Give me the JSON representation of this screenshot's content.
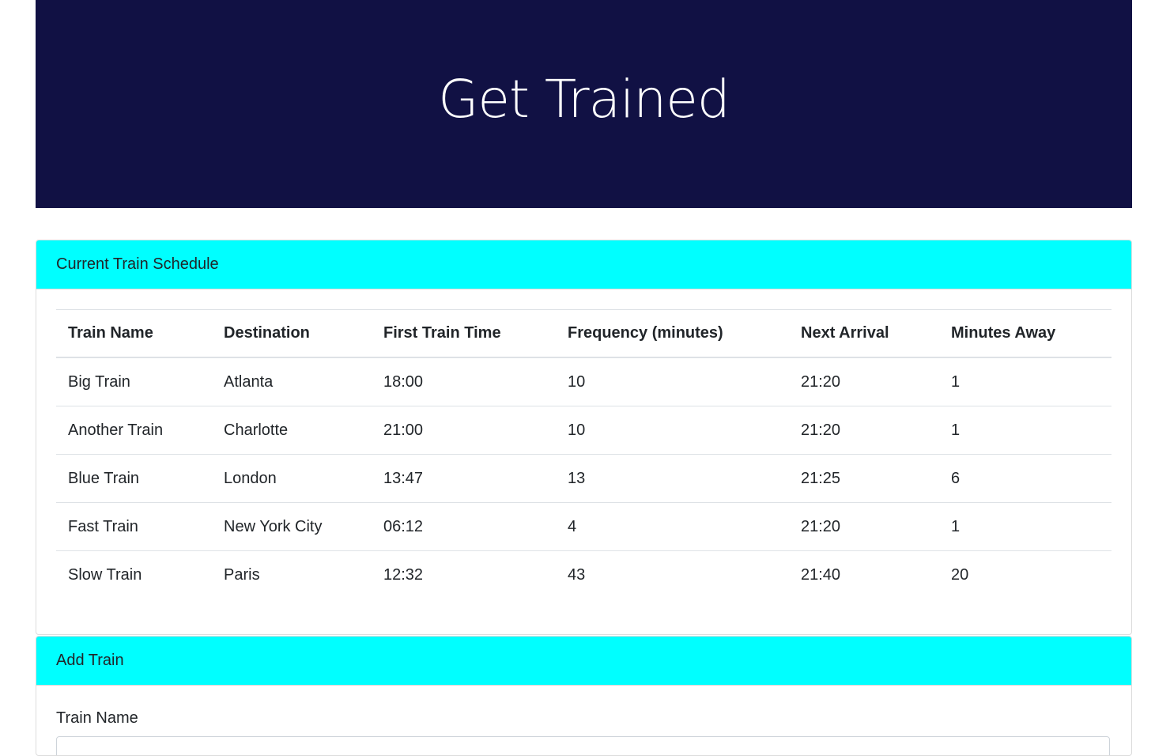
{
  "colors": {
    "jumbotron_bg": "#111144",
    "card_header_bg": "#00ffff"
  },
  "header": {
    "title": "Get Trained"
  },
  "schedule": {
    "title": "Current Train Schedule",
    "columns": [
      "Train Name",
      "Destination",
      "First Train Time",
      "Frequency (minutes)",
      "Next Arrival",
      "Minutes Away"
    ],
    "rows": [
      [
        "Big Train",
        "Atlanta",
        "18:00",
        "10",
        "21:20",
        "1"
      ],
      [
        "Another Train",
        "Charlotte",
        "21:00",
        "10",
        "21:20",
        "1"
      ],
      [
        "Blue Train",
        "London",
        "13:47",
        "13",
        "21:25",
        "6"
      ],
      [
        "Fast Train",
        "New York City",
        "06:12",
        "4",
        "21:20",
        "1"
      ],
      [
        "Slow Train",
        "Paris",
        "12:32",
        "43",
        "21:40",
        "20"
      ]
    ]
  },
  "add_train": {
    "title": "Add Train",
    "train_name_label": "Train Name",
    "train_name_value": ""
  }
}
